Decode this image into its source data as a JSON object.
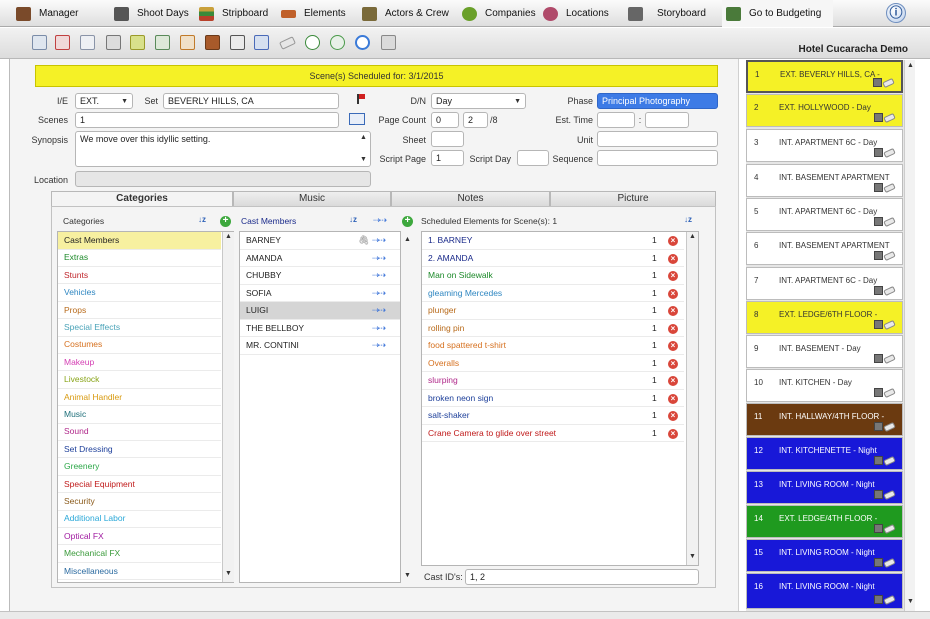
{
  "nav": [
    {
      "label": "Manager",
      "icon": "briefcase-icon",
      "color": "#7a4a2a"
    },
    {
      "label": "Shoot Days",
      "icon": "clapperboard-icon",
      "color": "#555555"
    },
    {
      "label": "Stripboard",
      "icon": "stripboard-icon",
      "color": "#b48a2a"
    },
    {
      "label": "Elements",
      "icon": "gun-icon",
      "color": "#c0602a"
    },
    {
      "label": "Actors & Crew",
      "icon": "actors-icon",
      "color": "#7a6a3a"
    },
    {
      "label": "Companies",
      "icon": "companies-icon",
      "color": "#6aa02a"
    },
    {
      "label": "Locations",
      "icon": "compass-icon",
      "color": "#b04a6a"
    },
    {
      "label": "Storyboard",
      "icon": "storyboard-icon",
      "color": "#666666"
    },
    {
      "label": "Go to Budgeting",
      "icon": "budget-icon",
      "color": "#4a7a3a"
    }
  ],
  "info_icon": "ⓘ",
  "project_name": "Hotel Cucaracha Demo",
  "banner": "Scene(s) Scheduled for: 3/1/2015",
  "form": {
    "ie_label": "I/E",
    "ie_value": "EXT.",
    "set_label": "Set",
    "set_value": "BEVERLY HILLS, CA",
    "dn_label": "D/N",
    "dn_value": "Day",
    "phase_label": "Phase",
    "phase_value": "Principal Photography",
    "scenes_label": "Scenes",
    "scenes_value": "1",
    "page_count_label": "Page Count",
    "page_whole": "0",
    "page_eighths": "2",
    "page_suffix": "/8",
    "est_time_label": "Est. Time",
    "est_time_sep": ":",
    "synopsis_label": "Synopsis",
    "synopsis_value": "We move over this idyllic setting.",
    "sheet_label": "Sheet",
    "unit_label": "Unit",
    "script_page_label": "Script Page",
    "script_page_value": "1",
    "script_day_label": "Script Day",
    "sequence_label": "Sequence",
    "location_label": "Location"
  },
  "tabs": [
    {
      "label": "Categories"
    },
    {
      "label": "Music"
    },
    {
      "label": "Notes"
    },
    {
      "label": "Picture"
    }
  ],
  "categories_header": "Categories",
  "categories": [
    {
      "label": "Cast Members",
      "color": "#222222"
    },
    {
      "label": "Extras",
      "color": "#1d8a2a"
    },
    {
      "label": "Stunts",
      "color": "#c0262c"
    },
    {
      "label": "Vehicles",
      "color": "#2e86c1"
    },
    {
      "label": "Props",
      "color": "#b86a1a"
    },
    {
      "label": "Special Effects",
      "color": "#4aa3b8"
    },
    {
      "label": "Costumes",
      "color": "#d6701e"
    },
    {
      "label": "Makeup",
      "color": "#d43fb3"
    },
    {
      "label": "Livestock",
      "color": "#88a418"
    },
    {
      "label": "Animal Handler",
      "color": "#d89a10"
    },
    {
      "label": "Music",
      "color": "#1e6f7a"
    },
    {
      "label": "Sound",
      "color": "#b0288a"
    },
    {
      "label": "Set Dressing",
      "color": "#1d3f9a"
    },
    {
      "label": "Greenery",
      "color": "#2ea84a"
    },
    {
      "label": "Special Equipment",
      "color": "#c01a1a"
    },
    {
      "label": "Security",
      "color": "#8a5a1a"
    },
    {
      "label": "Additional Labor",
      "color": "#2aa8d8"
    },
    {
      "label": "Optical FX",
      "color": "#a01aa0"
    },
    {
      "label": "Mechanical FX",
      "color": "#3a9a3a"
    },
    {
      "label": "Miscellaneous",
      "color": "#2a6aa0"
    }
  ],
  "cast_header": "Cast Members",
  "cast": [
    "BARNEY",
    "AMANDA",
    "CHUBBY",
    "SOFIA",
    "LUIGI",
    "THE BELLBOY",
    "MR. CONTINI"
  ],
  "scheduled_header": "Scheduled Elements for Scene(s): 1",
  "scheduled": [
    {
      "label": "1. BARNEY",
      "count": "1",
      "color": "#1a2a8a"
    },
    {
      "label": "2. AMANDA",
      "count": "1",
      "color": "#1a2a8a"
    },
    {
      "label": "Man on Sidewalk",
      "count": "1",
      "color": "#1d8a2a"
    },
    {
      "label": "gleaming Mercedes",
      "count": "1",
      "color": "#2e86c1"
    },
    {
      "label": "plunger",
      "count": "1",
      "color": "#b86a1a"
    },
    {
      "label": "rolling pin",
      "count": "1",
      "color": "#b86a1a"
    },
    {
      "label": "food spattered t-shirt",
      "count": "1",
      "color": "#d6701e"
    },
    {
      "label": "Overalls",
      "count": "1",
      "color": "#d6701e"
    },
    {
      "label": "slurping",
      "count": "1",
      "color": "#b0288a"
    },
    {
      "label": "broken neon sign",
      "count": "1",
      "color": "#1d3f9a"
    },
    {
      "label": "salt-shaker",
      "count": "1",
      "color": "#1d3f9a"
    },
    {
      "label": "Crane Camera to glide over street",
      "count": "1",
      "color": "#c01a1a"
    }
  ],
  "cast_ids_label": "Cast ID's:",
  "cast_ids_value": "1, 2",
  "strips": [
    {
      "num": "1",
      "text": "EXT. BEVERLY HILLS, CA  -",
      "bg": "#f5f126",
      "fg": "#333333"
    },
    {
      "num": "2",
      "text": "EXT. HOLLYWOOD  - Day",
      "bg": "#f5f126",
      "fg": "#333333"
    },
    {
      "num": "3",
      "text": "INT. APARTMENT 6C  - Day",
      "bg": "#ffffff",
      "fg": "#333333"
    },
    {
      "num": "4",
      "text": "INT. BASEMENT APARTMENT",
      "bg": "#ffffff",
      "fg": "#333333"
    },
    {
      "num": "5",
      "text": "INT. APARTMENT 6C  - Day",
      "bg": "#ffffff",
      "fg": "#333333"
    },
    {
      "num": "6",
      "text": "INT. BASEMENT APARTMENT",
      "bg": "#ffffff",
      "fg": "#333333"
    },
    {
      "num": "7",
      "text": "INT. APARTMENT 6C  - Day",
      "bg": "#ffffff",
      "fg": "#333333"
    },
    {
      "num": "8",
      "text": "EXT. LEDGE/6TH FLOOR  -",
      "bg": "#f5f126",
      "fg": "#333333"
    },
    {
      "num": "9",
      "text": "INT. BASEMENT  - Day",
      "bg": "#ffffff",
      "fg": "#333333"
    },
    {
      "num": "10",
      "text": "INT. KITCHEN  - Day",
      "bg": "#ffffff",
      "fg": "#333333"
    },
    {
      "num": "11",
      "text": "INT. HALLWAY/4TH FLOOR  -",
      "bg": "#6b3a10",
      "fg": "#ffffff"
    },
    {
      "num": "12",
      "text": "INT. KITCHENETTE  - Night",
      "bg": "#1818d8",
      "fg": "#ffffff"
    },
    {
      "num": "13",
      "text": "INT. LIVING ROOM  - Night",
      "bg": "#1818d8",
      "fg": "#ffffff"
    },
    {
      "num": "14",
      "text": "EXT. LEDGE/4TH FLOOR  -",
      "bg": "#1f9a1f",
      "fg": "#ffffff"
    },
    {
      "num": "15",
      "text": "INT. LIVING ROOM  - Night",
      "bg": "#1818d8",
      "fg": "#ffffff"
    },
    {
      "num": "16",
      "text": "INT. LIVING ROOM  - Night",
      "bg": "#1818d8",
      "fg": "#ffffff"
    }
  ]
}
